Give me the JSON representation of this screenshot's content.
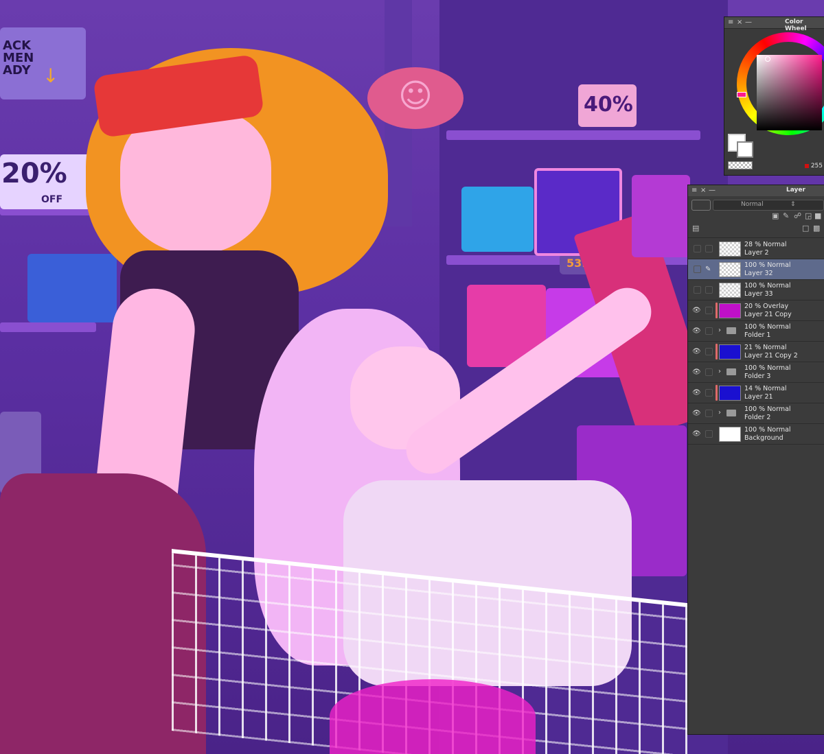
{
  "canvas": {
    "sign_left": "ACK\nMEN\nADY",
    "sign_discount": "20%",
    "sign_off": "OFF",
    "price_tag_40": "40%",
    "price_tag_53": "53."
  },
  "color_wheel_panel": {
    "title": "Color Wheel",
    "rgb_value": "255",
    "accent_color": "#ff1a8c"
  },
  "layer_panel": {
    "title": "Layer",
    "blend_mode": "Normal",
    "layers": [
      {
        "mode": "28 % Normal",
        "name": "Layer 2",
        "type": "raster",
        "thumb": "transparent",
        "visible": false,
        "selected": false,
        "clipped": false
      },
      {
        "mode": "100 % Normal",
        "name": "Layer 32",
        "type": "raster",
        "thumb": "transparent",
        "visible": false,
        "selected": true,
        "clipped": false
      },
      {
        "mode": "100 % Normal",
        "name": "Layer 33",
        "type": "raster",
        "thumb": "transparent",
        "visible": false,
        "selected": false,
        "clipped": false
      },
      {
        "mode": "20 % Overlay",
        "name": "Layer 21 Copy",
        "type": "raster",
        "thumb": "#c010c8",
        "visible": true,
        "selected": false,
        "clipped": true
      },
      {
        "mode": "100 % Normal",
        "name": "Folder 1",
        "type": "folder",
        "visible": true,
        "selected": false,
        "clipped": false
      },
      {
        "mode": "21 % Normal",
        "name": "Layer 21 Copy 2",
        "type": "raster",
        "thumb": "#1a10d0",
        "visible": true,
        "selected": false,
        "clipped": true
      },
      {
        "mode": "100 % Normal",
        "name": "Folder 3",
        "type": "folder",
        "visible": true,
        "selected": false,
        "clipped": false
      },
      {
        "mode": "14 % Normal",
        "name": "Layer 21",
        "type": "raster",
        "thumb": "#1a10d0",
        "visible": true,
        "selected": false,
        "clipped": true
      },
      {
        "mode": "100 % Normal",
        "name": "Folder 2",
        "type": "folder",
        "visible": true,
        "selected": false,
        "clipped": false
      },
      {
        "mode": "100 % Normal",
        "name": "Background",
        "type": "raster",
        "thumb": "#ffffff",
        "visible": true,
        "selected": false,
        "clipped": false
      }
    ]
  }
}
